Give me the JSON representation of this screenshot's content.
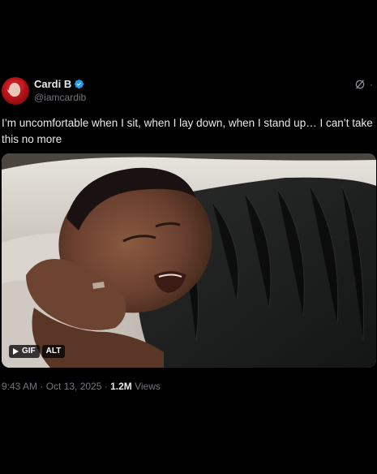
{
  "post": {
    "author": {
      "display_name": "Cardi B",
      "handle": "@iamcardib",
      "verified": true
    },
    "text": "I’m uncomfortable when I sit, when I lay down, when I stand up… I can’t take this no more",
    "media": {
      "badges": {
        "gif_label": "GIF",
        "alt_label": "ALT"
      }
    },
    "timestamp": "9:43 AM · Oct 13, 2025",
    "separator": " · ",
    "views_count": "1.2M",
    "views_label": " Views"
  },
  "icons": {
    "verified": "verified-badge-icon",
    "grok": "grok-icon",
    "more": "more-icon",
    "play": "play-icon"
  },
  "colors": {
    "background": "#000000",
    "text_primary": "#e7e9ea",
    "text_secondary": "#71767b",
    "verified_blue": "#1d9bf0"
  }
}
